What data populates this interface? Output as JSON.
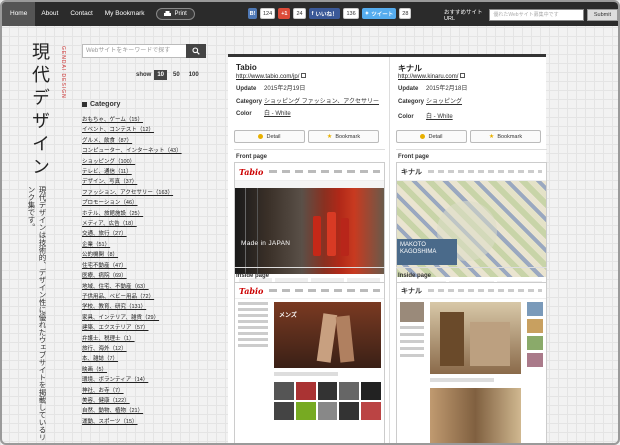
{
  "nav": {
    "home": "Home",
    "about": "About",
    "contact": "Contact",
    "bookmark": "My Bookmark",
    "print": "Print"
  },
  "social": {
    "hatena_count": "124",
    "gplus_label": "+1",
    "gplus_count": "24",
    "like_label": "いいね！",
    "like_count": "136",
    "tweet_label": "ツイート",
    "tweet_count": "28"
  },
  "topsearch": {
    "label": "おすすめサイトURL",
    "placeholder": "優れたWebサイト募集中です",
    "submit": "Submit"
  },
  "site": {
    "title": "現代デザイン",
    "subtitle": "GENDAI DESIGN",
    "description": "現代デザインは技術的、デザイン性に優れたウェブサイトを掲載しているリンク集です。"
  },
  "search": {
    "placeholder": "Webサイトをキーワードで探す"
  },
  "show": {
    "label": "show",
    "options": [
      "10",
      "50",
      "100"
    ]
  },
  "category": {
    "heading": "Category",
    "items": [
      "おもちゃ、ゲーム（15）",
      "イベント、コンテスト（12）",
      "グルメ、飲食（87）",
      "コンピューター、インターネット（43）",
      "ショッピング（100）",
      "テレビ、通信（11）",
      "デザイン、写真（37）",
      "ファッション、アクセサリー（163）",
      "プロモーション（46）",
      "ホテル、旅館施設（25）",
      "メディア、広告（18）",
      "交通、旅行（27）",
      "企業（51）",
      "公的機関（8）",
      "住宅不動産（47）",
      "医療、病院（69）",
      "地域、住宅、不動産（63）",
      "子供用品、ベビー用品（72）",
      "学校、教育、研究（131）",
      "家具、インテリア、雑貨（29）",
      "建築、エクステリア（57）",
      "弁護士、税理士（1）",
      "旅行、海外（12）",
      "本、雑誌（7）",
      "映画（5）",
      "環境、ボランティア（14）",
      "神社、お寺（7）",
      "美容、健康（122）",
      "自然、動物、植物（21）",
      "運動、スポーツ（15）"
    ]
  },
  "cards": [
    {
      "title": "Tabio",
      "url": "http://www.tabio.com/jp/",
      "update_label": "Update",
      "update": "2015年2月19日",
      "category_label": "Category",
      "categories": "ショッピング ファッション、アクセサリー",
      "color_label": "Color",
      "color": "白 - White",
      "detail": "Detail",
      "bookmark": "Bookmark",
      "front_label": "Front page",
      "inside_label": "Inside page"
    },
    {
      "title": "キナル",
      "url": "http://www.kinaru.com/",
      "update_label": "Update",
      "update": "2015年2月18日",
      "category_label": "Category",
      "categories": "ショッピング",
      "color_label": "Color",
      "color": "白 - White",
      "detail": "Detail",
      "bookmark": "Bookmark",
      "front_label": "Front page",
      "inside_label": "Inside page"
    }
  ],
  "shots": {
    "tabio_front_headline": "Made in JAPAN",
    "kinaru_front_headline": "MAKOTO KAGOSHIMA",
    "tabio_logo": "Tabio",
    "kinaru_logo": "キナル",
    "tabio_inside_word": "メンズ"
  },
  "colors": {
    "topbar": "#2b2b2b",
    "accent": "#e8b000",
    "hatena": "#4f79b6",
    "gplus": "#dd4b39",
    "facebook": "#3b5998",
    "twitter": "#55acee"
  }
}
